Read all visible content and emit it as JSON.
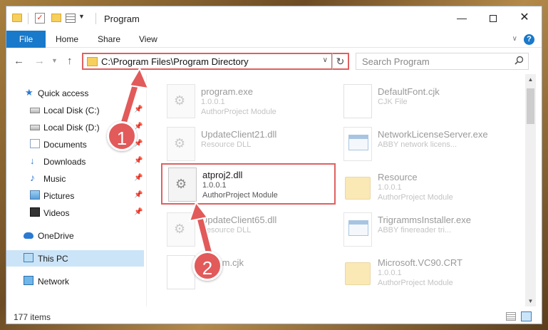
{
  "window": {
    "title": "Program",
    "minimize_glyph": "—",
    "close_glyph": "✕"
  },
  "ribbon": {
    "tabs": [
      {
        "label": "File"
      },
      {
        "label": "Home"
      },
      {
        "label": "Share"
      },
      {
        "label": "View"
      }
    ],
    "help_glyph": "?"
  },
  "navbar": {
    "back_glyph": "←",
    "forward_glyph": "→",
    "up_glyph": "↑",
    "address": "C:\\Program Files\\Program Directory",
    "refresh_glyph": "↻",
    "search_placeholder": "Search Program"
  },
  "sidebar": {
    "items": [
      {
        "label": "Quick access",
        "icon": "star-icon",
        "pinned": false
      },
      {
        "label": "Local Disk (C:)",
        "icon": "disk-icon",
        "pinned": true
      },
      {
        "label": "Local Disk (D:)",
        "icon": "disk-icon",
        "pinned": true
      },
      {
        "label": "Documents",
        "icon": "documents-icon",
        "pinned": true
      },
      {
        "label": "Downloads",
        "icon": "downloads-icon",
        "pinned": true
      },
      {
        "label": "Music",
        "icon": "music-icon",
        "pinned": true
      },
      {
        "label": "Pictures",
        "icon": "pictures-icon",
        "pinned": true
      },
      {
        "label": "Videos",
        "icon": "videos-icon",
        "pinned": true
      },
      {
        "label": "OneDrive",
        "icon": "onedrive-icon",
        "pinned": false
      },
      {
        "label": "This PC",
        "icon": "this-pc-icon",
        "pinned": false,
        "selected": true
      },
      {
        "label": "Network",
        "icon": "network-icon",
        "pinned": false
      }
    ]
  },
  "files": [
    {
      "name": "program.exe",
      "meta1": "1.0.0.1",
      "meta2": "AuthorProject Module",
      "icon": "executable-icon"
    },
    {
      "name": "DefaultFont.cjk",
      "meta1": "CJK File",
      "meta2": "",
      "icon": "document-icon"
    },
    {
      "name": "UpdateClient21.dll",
      "meta1": "Resource DLL",
      "meta2": "",
      "icon": "dll-gear-icon"
    },
    {
      "name": "NetworkLicenseServer.exe",
      "meta1": "ABBY network licens...",
      "meta2": "",
      "icon": "application-icon"
    },
    {
      "name": "atproj2.dll",
      "meta1": "1.0.0.1",
      "meta2": "AuthorProject Module",
      "icon": "dll-gear-icon",
      "highlighted": true
    },
    {
      "name": "Resource",
      "meta1": "1.0.0.1",
      "meta2": "AuthorProject Module",
      "icon": "folder-icon"
    },
    {
      "name": "UpdateClient65.dll",
      "meta1": "Resource DLL",
      "meta2": "",
      "icon": "dll-gear-icon"
    },
    {
      "name": "TrigrammsInstaller.exe",
      "meta1": "ABBY finereader tri...",
      "meta2": "",
      "icon": "application-icon"
    },
    {
      "name": "Fr...om.cjk",
      "meta1": "",
      "meta2": "",
      "icon": "document-icon"
    },
    {
      "name": "Microsoft.VC90.CRT",
      "meta1": "1.0.0.1",
      "meta2": "AuthorProject Module",
      "icon": "folder-icon"
    }
  ],
  "status": {
    "item_count": "177 items"
  },
  "annotations": {
    "step1": "1",
    "step2": "2",
    "color": "#e25a5a"
  },
  "colors": {
    "accent": "#1979ca",
    "selection": "#cce4f7",
    "highlight_border": "#e06060"
  }
}
